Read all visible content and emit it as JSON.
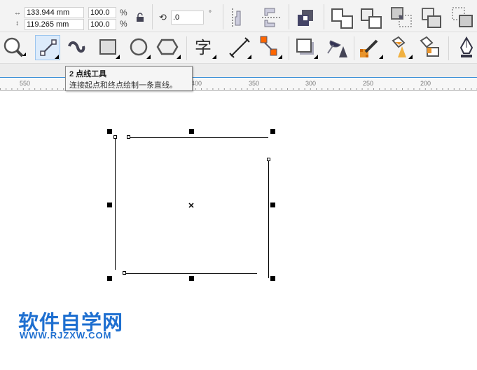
{
  "property_bar": {
    "width": "133.944 mm",
    "height": "119.265 mm",
    "scale_x": "100.0",
    "scale_y": "100.0",
    "percent": "%",
    "rotation": ".0",
    "degree": "°"
  },
  "tooltip": {
    "title": "2 点线工具",
    "description": "连接起点和终点绘制一条直线。"
  },
  "ruler": {
    "labels": [
      "550",
      "400",
      "350",
      "300",
      "250",
      "200"
    ]
  },
  "watermark": {
    "name": "软件自学网",
    "url": "WWW.RJZXW.COM"
  },
  "colors": {
    "accent": "#1e6fd0",
    "selection": "#dcebfb"
  }
}
